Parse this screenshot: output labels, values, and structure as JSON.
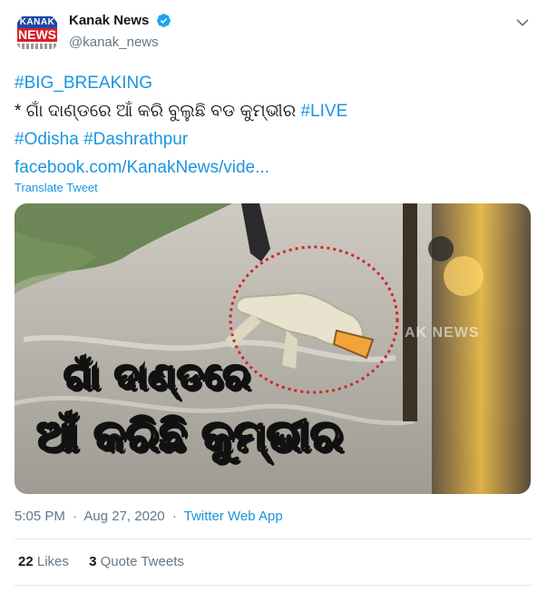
{
  "author": {
    "display_name": "Kanak News",
    "handle": "@kanak_news",
    "avatar_logo_top": "KANAK",
    "avatar_logo_main": "NEWS"
  },
  "tweet": {
    "line1": "#BIG_BREAKING",
    "line2_prefix": "* ଗାଁ ଦାଣ୍ଡରେ ଆଁ କରି ବୁଲୁଛି ବଡ କୁମ୍ଭୀର ",
    "line2_hashtag": "#LIVE",
    "line3_hashtag1": "#Odisha",
    "line3_hashtag2": "#Dashrathpur",
    "line4_link": "facebook.com/KanakNews/vide...",
    "translate_label": "Translate Tweet"
  },
  "media": {
    "overlay_line1": "ଗାଁ ଦାଣ୍ଡରେ",
    "overlay_line2": "ଆଁ କରିଛି କୁମ୍ଭୀର",
    "watermark": "AK NEWS"
  },
  "meta": {
    "time": "5:05 PM",
    "date": "Aug 27, 2020",
    "source": "Twitter Web App",
    "separator": "·"
  },
  "stats": {
    "likes_count": "22",
    "likes_label": "Likes",
    "quotes_count": "3",
    "quotes_label": "Quote Tweets"
  },
  "colors": {
    "link": "#1b95e0",
    "text": "#14171a",
    "secondary": "#657786",
    "verified": "#1da1f2",
    "overlay_yellow": "#f4c20d",
    "circle_red": "#d0262b"
  },
  "icons": {
    "verified": "verified-badge-icon",
    "caret": "chevron-down-icon"
  }
}
